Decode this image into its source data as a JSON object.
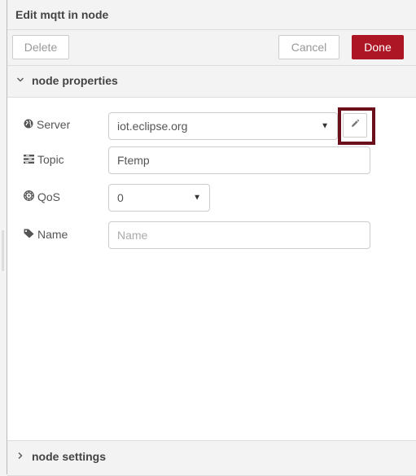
{
  "header": {
    "title": "Edit mqtt in node"
  },
  "toolbar": {
    "delete_label": "Delete",
    "cancel_label": "Cancel",
    "done_label": "Done"
  },
  "sections": {
    "properties_label": "node properties",
    "settings_label": "node settings"
  },
  "form": {
    "server": {
      "label": "Server",
      "value": "iot.eclipse.org"
    },
    "topic": {
      "label": "Topic",
      "value": "Ftemp"
    },
    "qos": {
      "label": "QoS",
      "value": "0"
    },
    "name": {
      "label": "Name",
      "value": "",
      "placeholder": "Name"
    }
  },
  "colors": {
    "done": "#ad1625",
    "highlight": "#6b0f1a"
  },
  "icons": [
    "globe-icon",
    "tasks-icon",
    "empire-icon",
    "tag-icon",
    "pencil-icon",
    "chevron-down-icon",
    "chevron-right-icon",
    "caret-down-icon"
  ]
}
